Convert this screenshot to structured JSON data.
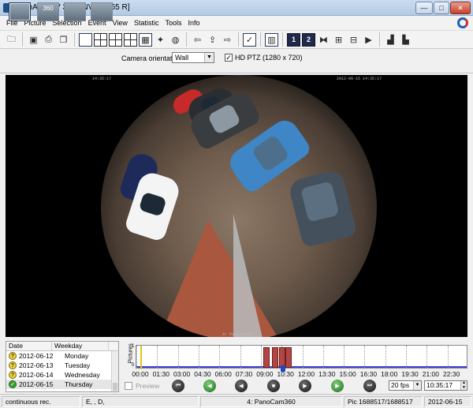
{
  "window": {
    "title": "CamArc32 V 3.60 [NV998765 R]",
    "minimize": "—",
    "maximize": "□",
    "close": "✕"
  },
  "menu": [
    "File",
    "Picture",
    "Selection",
    "Event",
    "View",
    "Statistic",
    "Tools",
    "Info"
  ],
  "toolbar": {
    "icons": [
      "folder-icon",
      "save-icon",
      "print-icon",
      "copy-icon",
      "layout-1-icon",
      "layout-4-icon",
      "layout-9-icon",
      "layout-16-icon",
      "calendar-icon",
      "satellite-icon",
      "globe-icon",
      "arrow-left-icon",
      "export-icon",
      "arrow-right-icon",
      "report-icon",
      "layout-select-icon",
      "monitor-1-icon",
      "monitor-2-icon",
      "zoom-fit-icon",
      "zoom-in-icon",
      "zoom-out-icon",
      "play-icon",
      "stats-icon",
      "histogram-icon"
    ],
    "monitor1_label": "1",
    "monitor2_label": "2"
  },
  "camera_modes": [
    {
      "name": "view-fisheye-button",
      "label": ""
    },
    {
      "name": "view-panorama-button",
      "label": "360"
    },
    {
      "name": "view-quad-button",
      "label": ""
    },
    {
      "name": "view-ptz-button",
      "label": ""
    }
  ],
  "camera": {
    "orientation_label": "Camera orientation:",
    "orientation_value": "Wall",
    "hd_ptz_checked": "✓",
    "hd_ptz_label": "HD PTZ (1280 x 720)"
  },
  "video": {
    "osd_top_left": "14:35:17",
    "osd_top_right": "2012-06-15 14:35:17",
    "osd_bottom": "4: PanoCam360"
  },
  "datelist": {
    "headers": [
      "Date",
      "Weekday"
    ],
    "rows": [
      {
        "date": "2012-06-12",
        "weekday": "Monday",
        "status": "?"
      },
      {
        "date": "2012-06-13",
        "weekday": "Tuesday",
        "status": "?"
      },
      {
        "date": "2012-06-14",
        "weekday": "Wednesday",
        "status": "?"
      },
      {
        "date": "2012-06-15",
        "weekday": "Thursday",
        "status": "✓"
      }
    ]
  },
  "timeline": {
    "ylabel": "Pictures",
    "ytick_top": "1",
    "ytick_bottom": "0",
    "xticks": [
      "00:00",
      "01:30",
      "03:00",
      "04:30",
      "06:00",
      "07:30",
      "09:00",
      "10:30",
      "12:00",
      "13:30",
      "15:00",
      "16:30",
      "18:00",
      "19:30",
      "21:00",
      "22:30"
    ],
    "bars_hours": [
      9.2,
      9.8,
      10.3,
      10.8
    ],
    "cursor_hour": 10.6,
    "marker_hour": 0.3
  },
  "playback": {
    "preview_label": "Preview",
    "buttons": [
      "skip-back-icon",
      "step-back-icon",
      "rewind-icon",
      "stop-icon",
      "play-icon",
      "forward-icon",
      "skip-forward-icon"
    ],
    "fps": "20 fps",
    "time": "10:35:17"
  },
  "status": {
    "mode": "continuous rec.",
    "flags": "E, , D,",
    "camera": "4: PanoCam360",
    "pic": "Pic 1688517/1688517",
    "date": "2012-06-15"
  }
}
